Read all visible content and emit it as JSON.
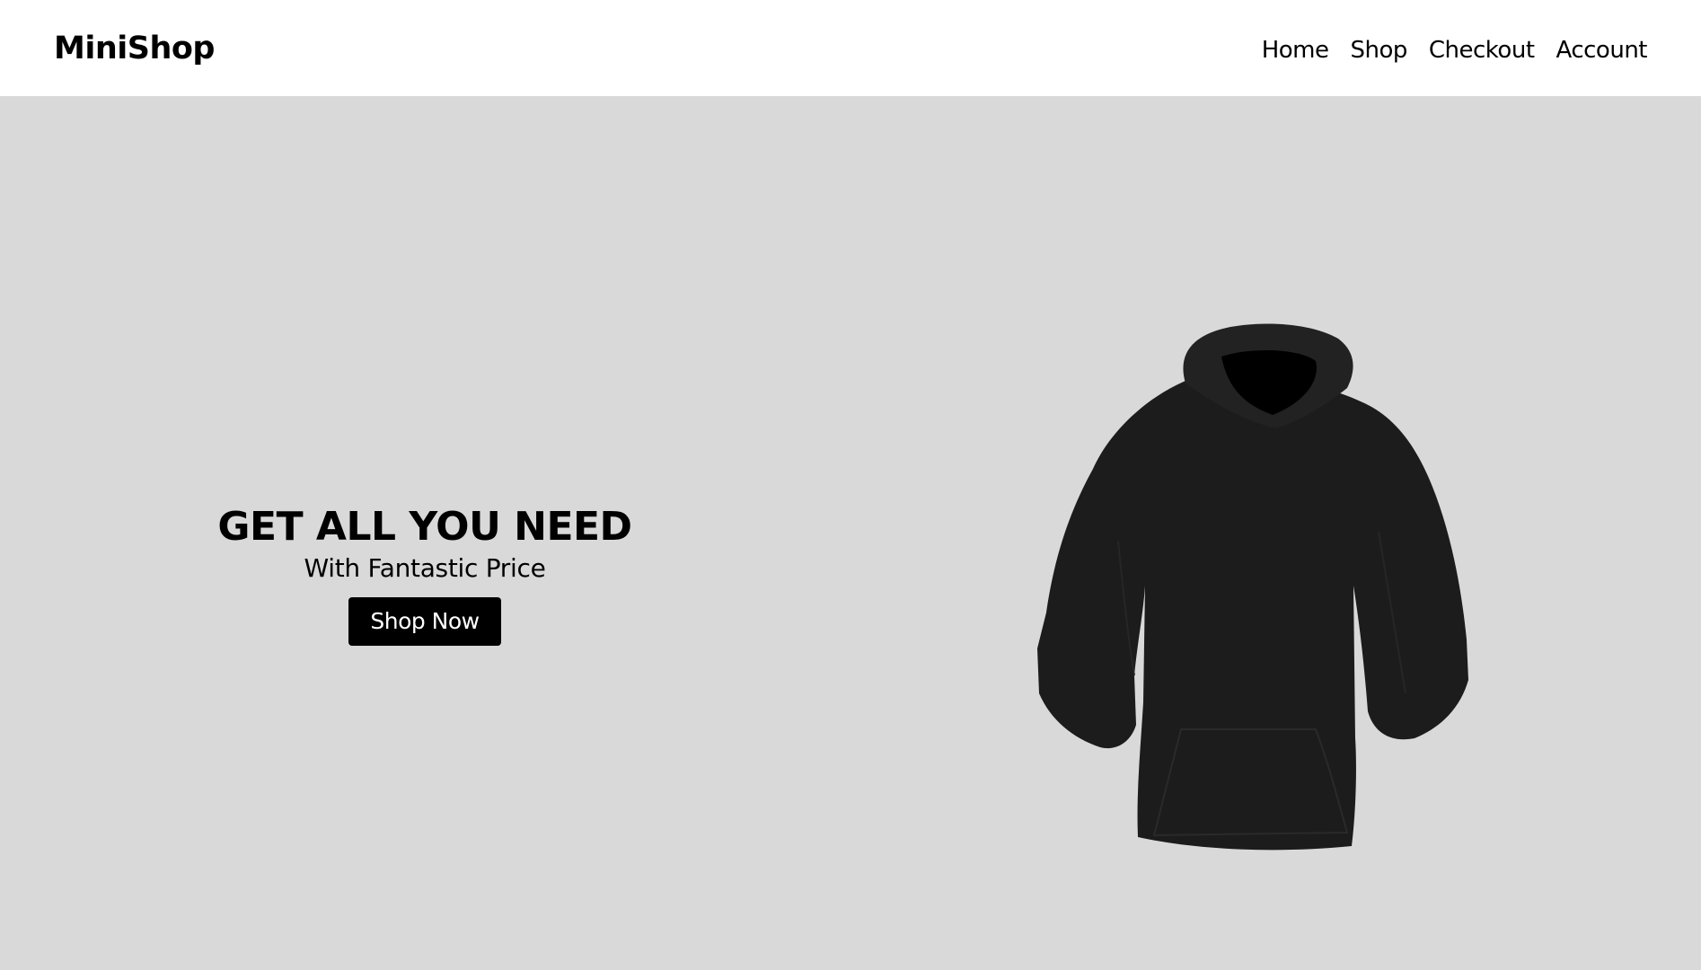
{
  "header": {
    "brand": "MiniShop",
    "nav": [
      "Home",
      "Shop",
      "Checkout",
      "Account"
    ]
  },
  "hero": {
    "title": "GET ALL YOU NEED",
    "subtitle": "With Fantastic Price",
    "cta_label": "Shop Now",
    "product_image": "black-hoodie"
  },
  "colors": {
    "header_bg": "#ffffff",
    "hero_bg": "#d9d9d9",
    "button_bg": "#000000",
    "button_text": "#ffffff",
    "text": "#000000",
    "product": "#1c1c1c"
  }
}
